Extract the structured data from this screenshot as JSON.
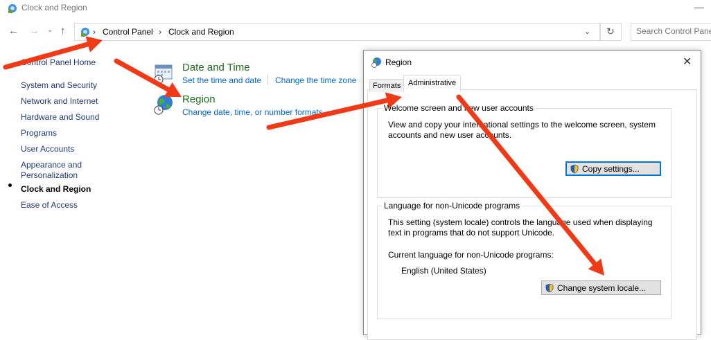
{
  "window": {
    "title": "Clock and Region",
    "minimize_glyph": "—"
  },
  "address_bar": {
    "crumbs": [
      "Control Panel",
      "Clock and Region"
    ],
    "separator": "›",
    "search_placeholder": "Search Control Panel",
    "icons": {
      "back": "back-arrow-icon",
      "forward": "forward-arrow-icon",
      "recent": "chevron-down-icon",
      "up": "up-arrow-icon",
      "refresh": "refresh-icon"
    },
    "glyphs": {
      "back": "←",
      "forward": "→",
      "recent": "⌄",
      "up": "↑",
      "dropdown": "⌄",
      "refresh": "↻"
    }
  },
  "left_nav": {
    "home": "Control Panel Home",
    "items": [
      {
        "label": "System and Security"
      },
      {
        "label": "Network and Internet"
      },
      {
        "label": "Hardware and Sound"
      },
      {
        "label": "Programs"
      },
      {
        "label": "User Accounts"
      },
      {
        "label": "Appearance and Personalization"
      },
      {
        "label": "Clock and Region",
        "active": true
      },
      {
        "label": "Ease of Access"
      }
    ]
  },
  "main": {
    "date_time": {
      "heading": "Date and Time",
      "links": [
        "Set the time and date",
        "Change the time zone"
      ],
      "icon": "calendar-clock-icon"
    },
    "region": {
      "heading": "Region",
      "links": [
        "Change date, time, or number formats"
      ],
      "icon": "globe-clock-icon"
    }
  },
  "dialog": {
    "title": "Region",
    "close_glyph": "✕",
    "tabs": [
      {
        "label": "Formats",
        "active": false
      },
      {
        "label": "Administrative",
        "active": true
      }
    ],
    "welcome_group": {
      "title": "Welcome screen and new user accounts",
      "text": "View and copy your international settings to the welcome screen, system accounts and new user accounts.",
      "button": "Copy settings..."
    },
    "non_unicode_group": {
      "title": "Language for non-Unicode programs",
      "text": "This setting (system locale) controls the language used when displaying text in programs that do not support Unicode.",
      "current_label": "Current language for non-Unicode programs:",
      "current_value": "English (United States)",
      "button": "Change system locale..."
    }
  },
  "colors": {
    "arrow": "#f03a17",
    "link": "#0066cc",
    "heading": "#1e6b1e",
    "nav_link": "#1c3a70",
    "focus_border": "#0078d7"
  }
}
